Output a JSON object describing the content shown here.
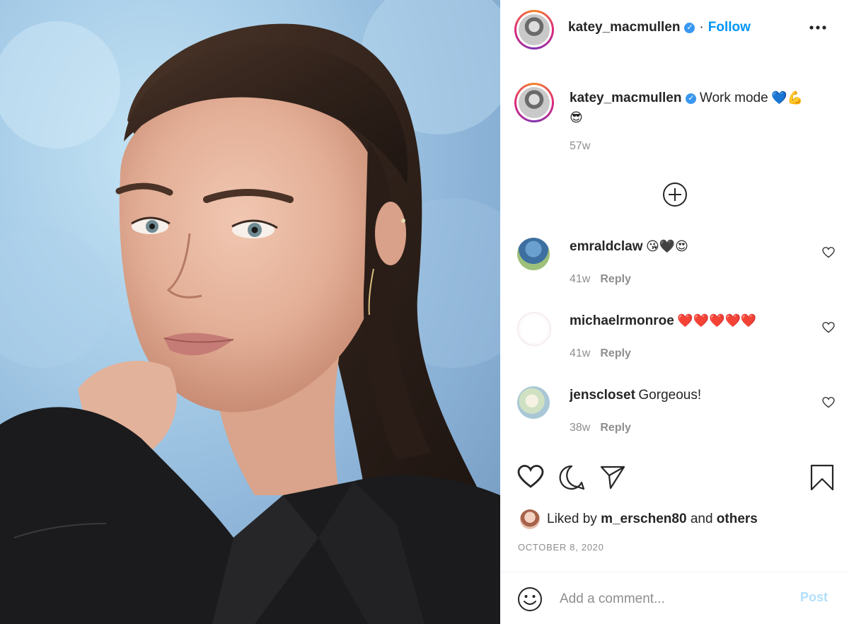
{
  "header": {
    "username": "katey_macmullen",
    "separator": "·",
    "follow_label": "Follow",
    "more_icon": "more-horizontal-icon"
  },
  "caption": {
    "username": "katey_macmullen",
    "text": "Work mode",
    "emoji": "💙💪",
    "emoji2": "😎",
    "time": "57w"
  },
  "load_more_icon": "plus-circle-icon",
  "comments": [
    {
      "username": "emraldclaw",
      "text": "",
      "emoji": "😘🖤😍",
      "time": "41w",
      "reply_label": "Reply"
    },
    {
      "username": "michaelrmonroe",
      "text": "",
      "emoji": "❤️❤️❤️❤️❤️",
      "time": "41w",
      "reply_label": "Reply"
    },
    {
      "username": "jenscloset",
      "text": "Gorgeous!",
      "emoji": "",
      "time": "38w",
      "reply_label": "Reply"
    }
  ],
  "actions": {
    "like_icon": "heart-icon",
    "comment_icon": "comment-icon",
    "share_icon": "paper-plane-icon",
    "save_icon": "bookmark-icon"
  },
  "likes": {
    "prefix": "Liked by",
    "user": "m_erschen80",
    "joiner": "and",
    "others": "others"
  },
  "date": "OCTOBER 8, 2020",
  "add_comment": {
    "placeholder": "Add a comment...",
    "post_label": "Post",
    "emoji_icon": "smiley-icon"
  },
  "colors": {
    "link": "#0095f6",
    "muted": "#8e8e8e",
    "verified": "#3897f0",
    "post_disabled": "#b2dffc"
  }
}
